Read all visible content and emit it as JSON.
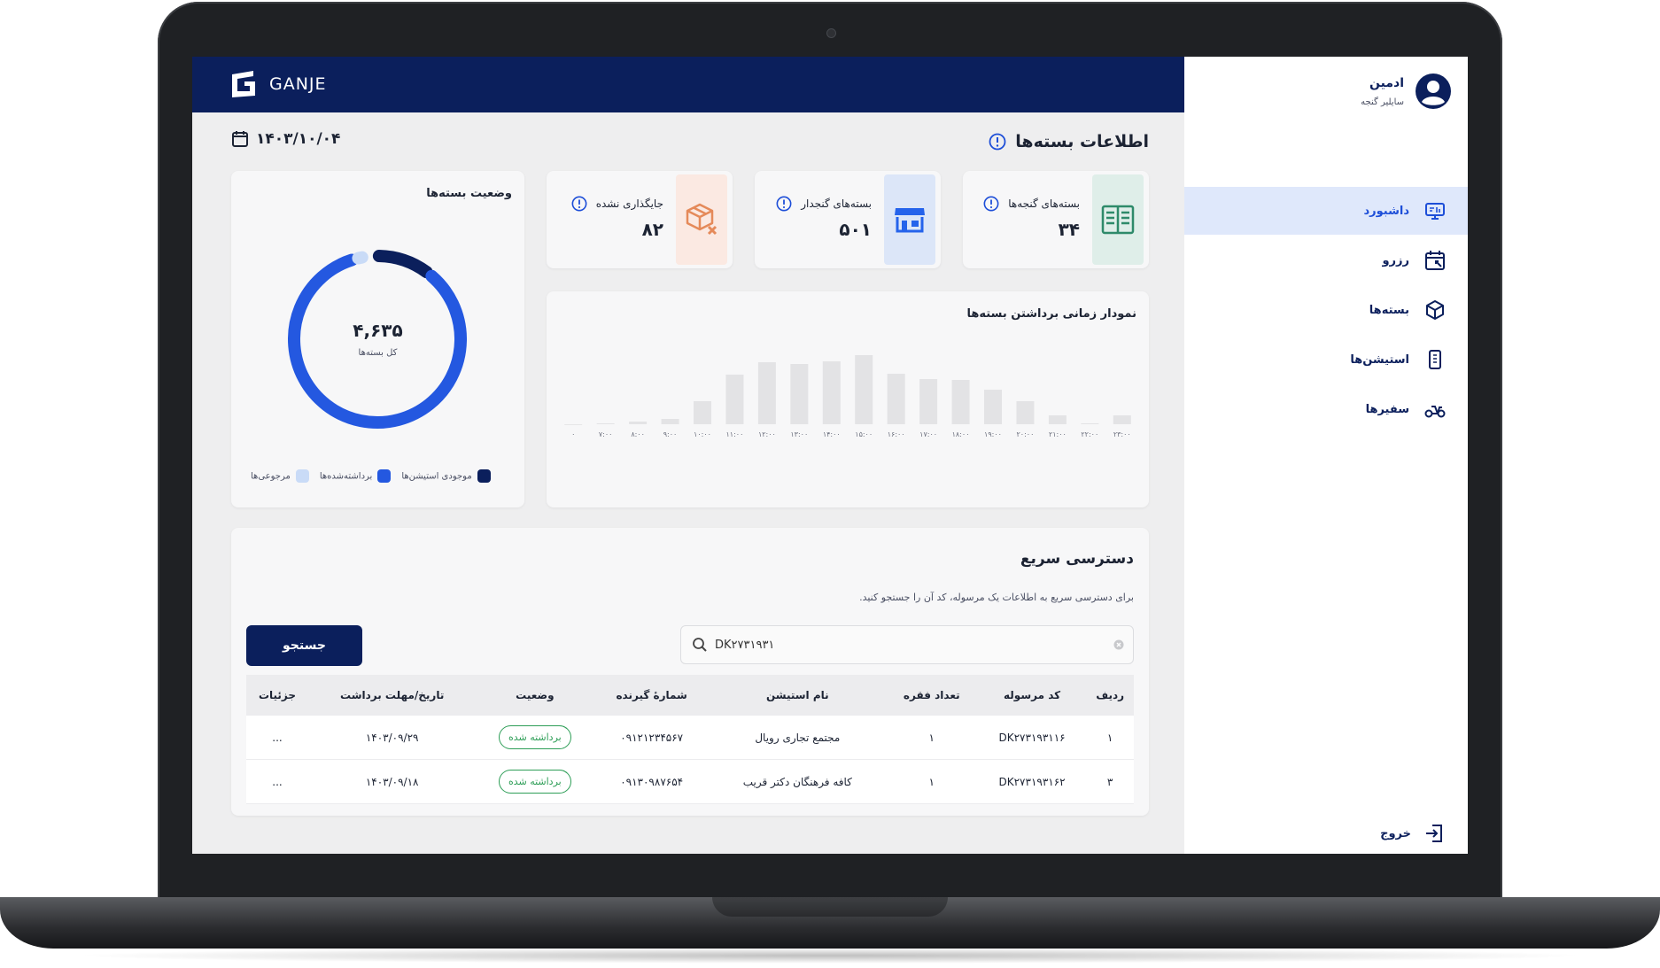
{
  "brand": {
    "name": "GANJE"
  },
  "user": {
    "name": "ادمین",
    "role": "سایلیر گنجه"
  },
  "nav": [
    {
      "label": "داشبورد",
      "icon": "dashboard-icon",
      "active": true
    },
    {
      "label": "رزرو",
      "icon": "calendar-icon",
      "active": false
    },
    {
      "label": "بسته‌ها",
      "icon": "box-icon",
      "active": false
    },
    {
      "label": "استیشن‌ها",
      "icon": "station-icon",
      "active": false
    },
    {
      "label": "سفیرها",
      "icon": "courier-icon",
      "active": false
    }
  ],
  "logout_label": "خروج",
  "header": {
    "title": "اطلاعات بسته‌ها",
    "date": "۱۴۰۳/۱۰/۰۴"
  },
  "stats": [
    {
      "label": "بسته‌های گنجه‌ها",
      "value": "۳۴",
      "icon": "book-icon",
      "icon_bg": "#dfeee9",
      "icon_color": "#2e8a6a"
    },
    {
      "label": "بسته‌های گنجدار",
      "value": "۵۰۱",
      "icon": "store-icon",
      "icon_bg": "#dce6f8",
      "icon_color": "#2563eb"
    },
    {
      "label": "جایگذاری نشده",
      "value": "۸۲",
      "icon": "box-x-icon",
      "icon_bg": "#fbe9e2",
      "icon_color": "#e58a5a"
    }
  ],
  "donut": {
    "title": "وضعیت بسته‌ها",
    "total": "۴,۶۳۵",
    "total_label": "کل بسته‌ها",
    "segments": [
      {
        "label": "موجودی استیشن‌ها",
        "color": "#0b1f5c",
        "fraction": 0.11
      },
      {
        "label": "برداشته‌شده‌ها",
        "color": "#2458e0",
        "fraction": 0.85
      },
      {
        "label": "مرجوعی‌ها",
        "color": "#c9dbf7",
        "fraction": 0.02
      }
    ]
  },
  "chart_data": {
    "type": "bar",
    "title": "نمودار زمانی برداشتن بسته‌ها",
    "categories": [
      "۰",
      "۷:۰۰",
      "۸:۰۰",
      "۹:۰۰",
      "۱۰:۰۰",
      "۱۱:۰۰",
      "۱۲:۰۰",
      "۱۳:۰۰",
      "۱۴:۰۰",
      "۱۵:۰۰",
      "۱۶:۰۰",
      "۱۷:۰۰",
      "۱۸:۰۰",
      "۱۹:۰۰",
      "۲۰:۰۰",
      "۲۱:۰۰",
      "۲۲:۰۰",
      "۲۳:۰۰"
    ],
    "values": [
      0,
      1,
      3,
      6,
      26,
      56,
      70,
      68,
      71,
      78,
      57,
      51,
      50,
      39,
      26,
      10,
      1,
      10
    ],
    "ylim": [
      0,
      100
    ],
    "grid": false,
    "color": "#e3e3e5"
  },
  "quick_access": {
    "title": "دسترسی سریع",
    "subtitle": "برای دسترسی سریع به اطلاعات یک مرسوله، کد آن را جستجو کنید.",
    "search_value": "DK۲۷۳۱۹۳۱",
    "search_button": "جستجو",
    "columns": [
      "ردیف",
      "کد مرسوله",
      "تعداد فقره",
      "نام استیشن",
      "شمارهٔ گیرنده",
      "وضعیت",
      "تاریخ/مهلت برداشت",
      "جزئیات"
    ],
    "rows": [
      [
        "۱",
        "DK۲۷۳۱۹۳۱۱۶",
        "۱",
        "مجتمع تجاری رویال",
        "۰۹۱۲۱۲۳۴۵۶۷",
        "برداشته شده",
        "۱۴۰۳/۰۹/۲۹",
        "..."
      ],
      [
        "۳",
        "DK۲۷۳۱۹۳۱۶۲",
        "۱",
        "کافه فرهنگان دکتر قریب",
        "۰۹۱۳۰۹۸۷۶۵۴",
        "برداشته شده",
        "۱۴۰۳/۰۹/۱۸",
        "..."
      ]
    ]
  }
}
